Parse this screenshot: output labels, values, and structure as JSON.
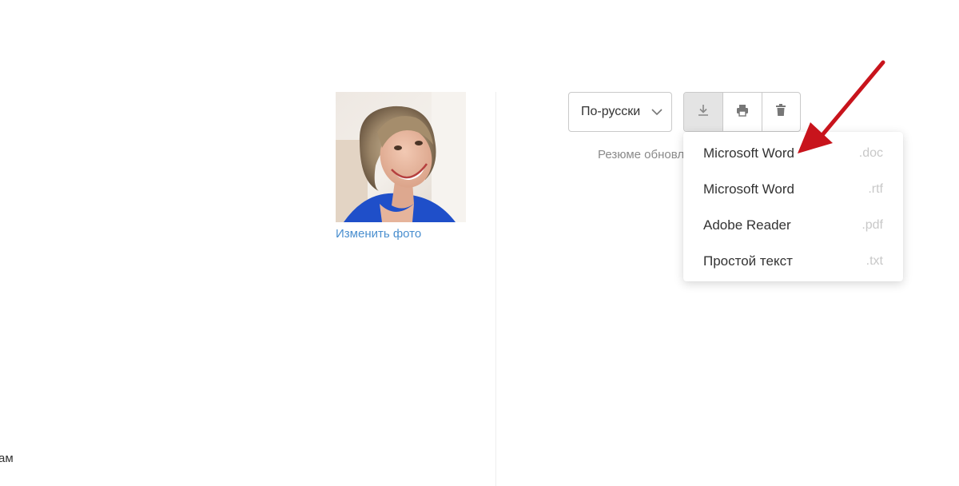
{
  "left_fragment": "ам",
  "profile": {
    "change_photo_label": "Изменить фото"
  },
  "toolbar": {
    "language_label": "По-русски",
    "download_icon": "download-icon",
    "print_icon": "print-icon",
    "delete_icon": "trash-icon"
  },
  "status": {
    "updated_text": "Резюме обновл"
  },
  "download_menu": {
    "items": [
      {
        "app": "Microsoft Word",
        "ext": ".doc"
      },
      {
        "app": "Microsoft Word",
        "ext": ".rtf"
      },
      {
        "app": "Adobe Reader",
        "ext": ".pdf"
      },
      {
        "app": "Простой текст",
        "ext": ".txt"
      }
    ]
  },
  "colors": {
    "link": "#4a8fcf",
    "annotation_arrow": "#c8141c",
    "active_button_bg": "#e4e4e4"
  }
}
